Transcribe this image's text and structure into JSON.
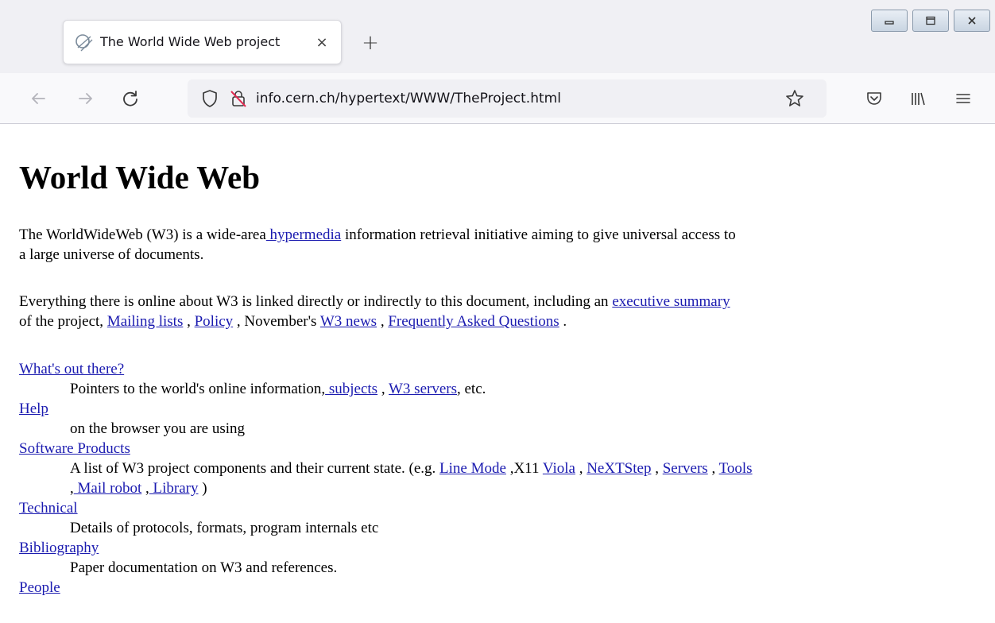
{
  "browser": {
    "tab_title": "The World Wide Web project",
    "tab_close": "×",
    "new_tab": "+",
    "url": "info.cern.ch/hypertext/WWW/TheProject.html"
  },
  "colors": {
    "link": "#1b1bb0",
    "chrome_bg": "#f0f0f4",
    "page_bg": "#ffffff"
  },
  "icons": [
    "back-icon",
    "forward-icon",
    "reload-icon",
    "shield-icon",
    "insecure-lock-icon",
    "bookmark-star-icon",
    "pocket-icon",
    "library-icon",
    "menu-icon",
    "minimize-icon",
    "maximize-icon",
    "close-window-icon",
    "favicon"
  ],
  "page": {
    "heading": "World Wide Web",
    "p1": {
      "t1": "The WorldWideWeb (W3) is a wide-area",
      "link_hypermedia": " hypermedia",
      "t2": " information retrieval initiative aiming to give universal access to",
      "t3": "a large universe of documents."
    },
    "p2": {
      "t1": "Everything there is online about W3 is linked directly or indirectly to this document, including an ",
      "link_exec": "executive summary",
      "t2": "of the project, ",
      "link_mailing": "Mailing lists",
      "t3": " , ",
      "link_policy": "Policy",
      "t4": " , November's ",
      "link_news": "W3 news",
      "t5": " , ",
      "link_faq": "Frequently Asked Questions",
      "t6": " ."
    },
    "list": {
      "whats_out": "What's out there?",
      "whats_desc1": "Pointers to the world's online information,",
      "whats_subjects": " subjects",
      "whats_sep": " , ",
      "whats_servers": "W3 servers",
      "whats_end": ", etc.",
      "help": "Help",
      "help_desc": "on the browser you are using",
      "software": "Software Products",
      "software_desc": "A list of W3 project components and their current state. (e.g. ",
      "line_mode": "Line Mode",
      "x11": " ,X11 ",
      "viola": "Viola",
      "sep": " , ",
      "nextstep": "NeXTStep",
      "servers": "Servers",
      "tools": "Tools",
      "comma_pre": ",",
      "mail_robot": " Mail robot",
      "comma_lib": " ,",
      "library": " Library",
      "close_paren": " )",
      "technical": "Technical",
      "technical_desc": "Details of protocols, formats, program internals etc",
      "bibliography": "Bibliography",
      "bibliography_desc": "Paper documentation on W3 and references.",
      "people": "People"
    }
  }
}
